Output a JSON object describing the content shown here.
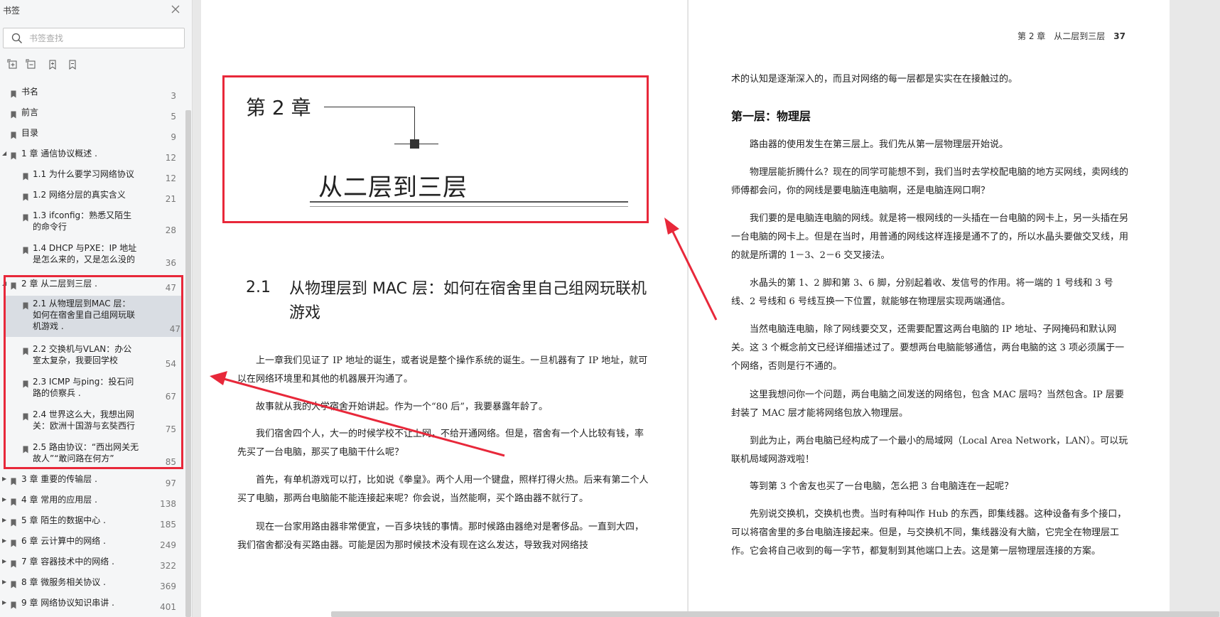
{
  "sidebar": {
    "title": "书签",
    "search_placeholder": "书签查找",
    "bookmarks": [
      {
        "label": "书名",
        "page": "3",
        "level": 0
      },
      {
        "label": "前言",
        "page": "5",
        "level": 0
      },
      {
        "label": "目录",
        "page": "9",
        "level": 0
      },
      {
        "label": "1 章 通信协议概述 .",
        "page": "12",
        "level": 0,
        "expanded": true
      },
      {
        "label": "1.1 为什么要学习网络协议",
        "page": "12",
        "level": 1
      },
      {
        "label": "1.2 网络分层的真实含义",
        "page": "21",
        "level": 1
      },
      {
        "label": "1.3 ifconfig：熟悉又陌生\n的命令行",
        "page": "28",
        "level": 1
      },
      {
        "label": "1.4 DHCP 与PXE：IP 地址\n是怎么来的，又是怎么没的",
        "page": "36",
        "level": 1
      },
      {
        "label": "2 章 从二层到三层 .",
        "page": "47",
        "level": 0,
        "expanded": true
      },
      {
        "label": "2.1 从物理层到MAC 层：\n如何在宿舍里自己组网玩联\n机游戏 .",
        "page": "47",
        "level": 1,
        "selected": true
      },
      {
        "label": "2.2 交换机与VLAN：办公\n室太复杂，我要回学校",
        "page": "54",
        "level": 1
      },
      {
        "label": "2.3 ICMP 与ping：投石问\n路的侦察兵 .",
        "page": "67",
        "level": 1
      },
      {
        "label": "2.4 世界这么大，我想出网\n关：欧洲十国游与玄奘西行",
        "page": "75",
        "level": 1
      },
      {
        "label": "2.5 路由协议：“西出网关无\n故人”“敢问路在何方”",
        "page": "85",
        "level": 1
      },
      {
        "label": "3 章 重要的传输层 .",
        "page": "97",
        "level": 0,
        "expanded": false
      },
      {
        "label": "4 章 常用的应用层 .",
        "page": "138",
        "level": 0,
        "expanded": false
      },
      {
        "label": "5 章 陌生的数据中心 .",
        "page": "185",
        "level": 0,
        "expanded": false
      },
      {
        "label": "6 章 云计算中的网络 .",
        "page": "249",
        "level": 0,
        "expanded": false
      },
      {
        "label": "7 章 容器技术中的网络 .",
        "page": "322",
        "level": 0,
        "expanded": false
      },
      {
        "label": "8 章 微服务相关协议 .",
        "page": "369",
        "level": 0,
        "expanded": false
      },
      {
        "label": "9 章 网络协议知识串讲 .",
        "page": "401",
        "level": 0,
        "expanded": false
      }
    ]
  },
  "left_page": {
    "chapter_num": "第 2 章",
    "chapter_title": "从二层到三层",
    "section_num": "2.1",
    "section_title": "从物理层到 MAC 层：如何在宿舍里自己组网玩联机游戏",
    "paragraphs": [
      "上一章我们见证了 IP 地址的诞生，或者说是整个操作系统的诞生。一旦机器有了 IP 地址，就可以在网络环境里和其他的机器展开沟通了。",
      "故事就从我的大学宿舍开始讲起。作为一个“80 后”，我要暴露年龄了。",
      "我们宿舍四个人，大一的时候学校不让上网，不给开通网络。但是，宿舍有一个人比较有钱，率先买了一台电脑，那买了电脑干什么呢？",
      "首先，有单机游戏可以打，比如说《拳皇》。两个人用一个键盘，照样打得火热。后来有第二个人买了电脑，那两台电脑能不能连接起来呢？你会说，当然能啊，买个路由器不就行了。",
      "现在一台家用路由器非常便宜，一百多块钱的事情。那时候路由器绝对是奢侈品。一直到大四，我们宿舍都没有买路由器。可能是因为那时候技术没有现在这么发达，导致我对网络技"
    ]
  },
  "right_page": {
    "running_head": "第 2 章　从二层到三层",
    "page_number": "37",
    "heading": "第一层：物理层",
    "first_line": "术的认知是逐渐深入的，而且对网络的每一层都是实实在在接触过的。",
    "paragraphs": [
      "路由器的使用发生在第三层上。我们先从第一层物理层开始说。",
      "物理层能折腾什么？现在的同学可能想不到，我们当时去学校配电脑的地方买网线，卖网线的师傅都会问，你的网线是要电脑连电脑啊，还是电脑连网口啊？",
      "我们要的是电脑连电脑的网线。就是将一根网线的一头插在一台电脑的网卡上，另一头插在另一台电脑的网卡上。但是在当时，用普通的网线这样连接是通不了的，所以水晶头要做交叉线，用的就是所谓的 1－3、2－6 交叉接法。",
      "水晶头的第 1、2 脚和第 3、6 脚，分别起着收、发信号的作用。将一端的 1 号线和 3 号线、2 号线和 6 号线互换一下位置，就能够在物理层实现两端通信。",
      "当然电脑连电脑，除了网线要交叉，还需要配置这两台电脑的 IP 地址、子网掩码和默认网关。这 3 个概念前文已经详细描述过了。要想两台电脑能够通信，两台电脑的这 3 项必须属于一个网络，否则是行不通的。",
      "这里我想问你一个问题，两台电脑之间发送的网络包，包含 MAC 层吗？当然包含。IP 层要封装了 MAC 层才能将网络包放入物理层。",
      "到此为止，两台电脑已经构成了一个最小的局域网（Local Area Network，LAN）。可以玩联机局域网游戏啦！",
      "等到第 3 个舍友也买了一台电脑，怎么把 3 台电脑连在一起呢？",
      "先别说交换机，交换机也贵。当时有种叫作 Hub 的东西，即集线器。这种设备有多个接口，可以将宿舍里的多台电脑连接起来。但是，与交换机不同，集线器没有大脑，它完全在物理层工作。它会将自己收到的每一字节，都复制到其他端口上去。这是第一层物理层连接的方案。"
    ]
  },
  "colors": {
    "annotation_red": "#e8283a",
    "sidebar_bg": "#f5f6f7",
    "selected_row": "#d9dde3"
  }
}
